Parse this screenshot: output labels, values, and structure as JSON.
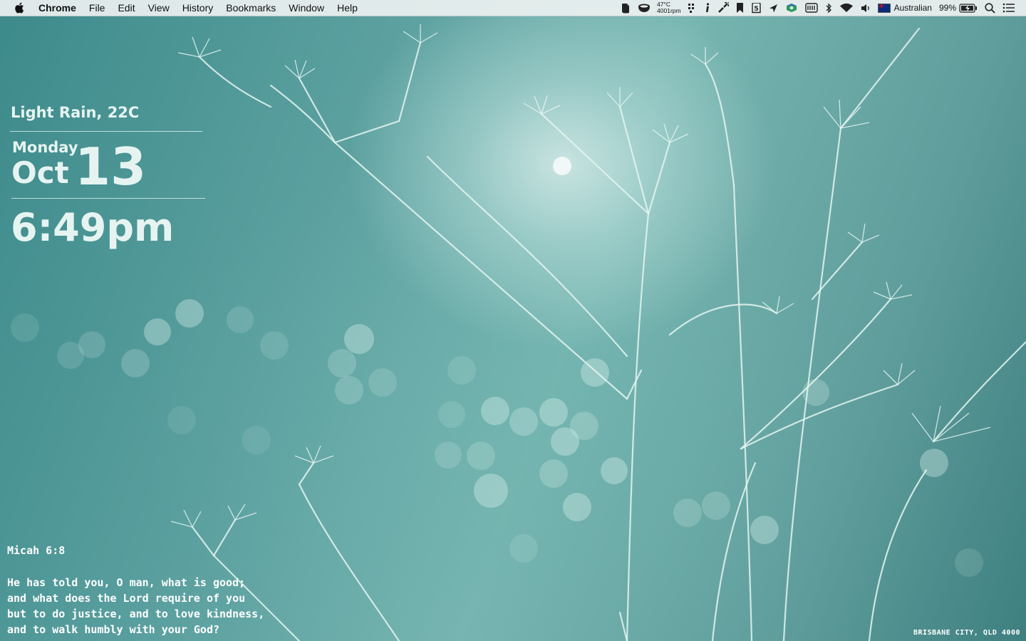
{
  "menubar": {
    "app_name": "Chrome",
    "menus": [
      "File",
      "Edit",
      "View",
      "History",
      "Bookmarks",
      "Window",
      "Help"
    ],
    "status": {
      "cpu_temp": "47°C",
      "fan_speed": "4001rpm",
      "input_source": "Australian",
      "battery_percent": "99%"
    }
  },
  "widgets": {
    "weather": "Light Rain, 22C",
    "day_name": "Monday",
    "month": "Oct",
    "day_number": "13",
    "time": "6:49pm",
    "verse_reference": "Micah 6:8",
    "verse_text": "He has told you, O man, what is good;\nand what does the Lord require of you\nbut to do justice, and to love kindness,\nand to walk humbly with your God?",
    "location": "BRISBANE CITY, QLD 4000"
  },
  "colors": {
    "menubar_bg": "#ecf0f0",
    "wallpaper_teal": "#5fa3a2",
    "widget_text": "#e6f4f1"
  },
  "icons": [
    "apple-logo-icon",
    "evernote-icon",
    "coffee-cup-icon",
    "dropbox-icon",
    "info-icon",
    "tools-icon",
    "bookmark-icon",
    "html5-icon",
    "location-arrow-icon",
    "growl-icon",
    "keyboard-icon",
    "bluetooth-icon",
    "wifi-icon",
    "volume-icon",
    "flag-icon",
    "battery-icon",
    "spotlight-search-icon",
    "notification-center-icon"
  ]
}
